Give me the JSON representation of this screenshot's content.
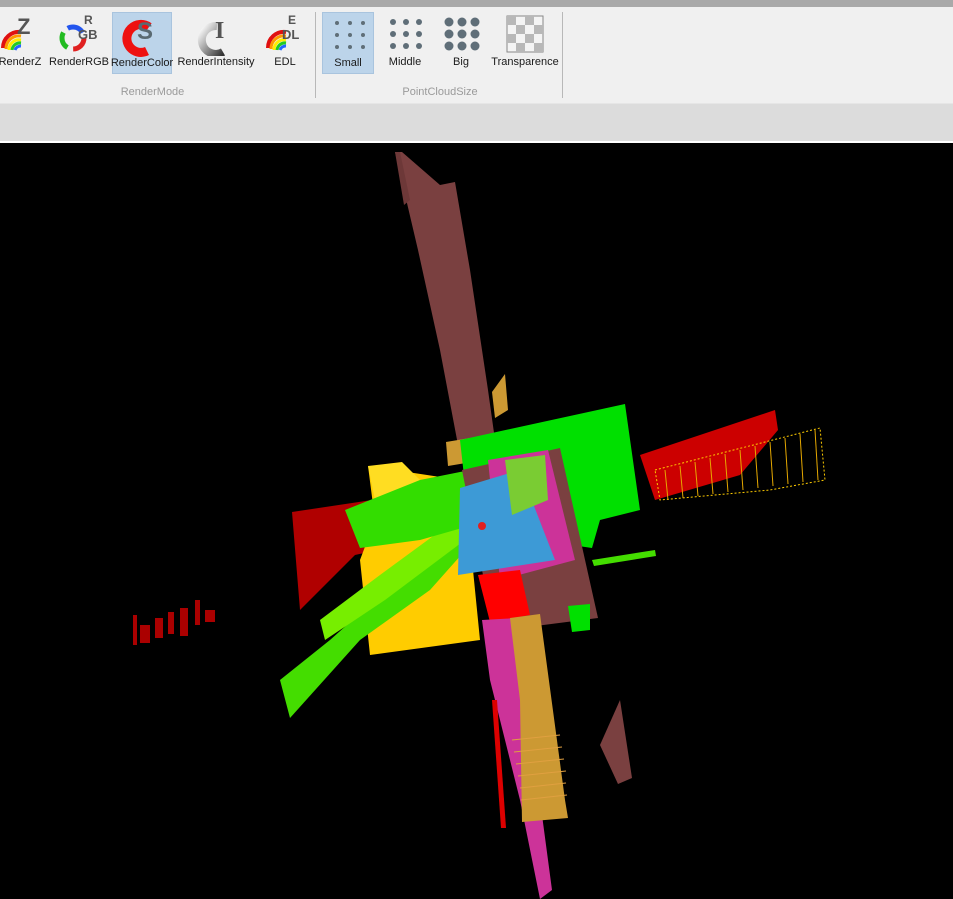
{
  "ribbon": {
    "render_mode": {
      "group_label": "RenderMode",
      "tools": [
        {
          "label": "RenderZ",
          "icon": "render-z-icon",
          "selected": false
        },
        {
          "label": "RenderRGB",
          "icon": "render-rgb-icon",
          "selected": false
        },
        {
          "label": "RenderColor",
          "icon": "render-color-icon",
          "selected": true
        },
        {
          "label": "RenderIntensity",
          "icon": "render-intensity-icon",
          "selected": false
        },
        {
          "label": "EDL",
          "icon": "edl-icon",
          "selected": false
        }
      ]
    },
    "point_cloud_size": {
      "group_label": "PointCloudSize",
      "tools": [
        {
          "label": "Small",
          "icon": "small-dots-icon",
          "selected": true
        },
        {
          "label": "Middle",
          "icon": "middle-dots-icon",
          "selected": false
        },
        {
          "label": "Big",
          "icon": "big-dots-icon",
          "selected": false
        },
        {
          "label": "Transparence",
          "icon": "transparence-icon",
          "selected": false
        }
      ]
    }
  },
  "colors": {
    "ribbon_bg": "#f0f0f0",
    "selected_bg": "#bcd4ea",
    "viewport_bg": "#000000",
    "segment_brown": "#7a4040",
    "segment_green": "#00e000",
    "segment_red": "#cc0000",
    "segment_yellow": "#ffcc00",
    "segment_blue": "#3d9ad6",
    "segment_magenta": "#cc3399",
    "segment_lime": "#66e000",
    "segment_orange": "#cc9933"
  }
}
